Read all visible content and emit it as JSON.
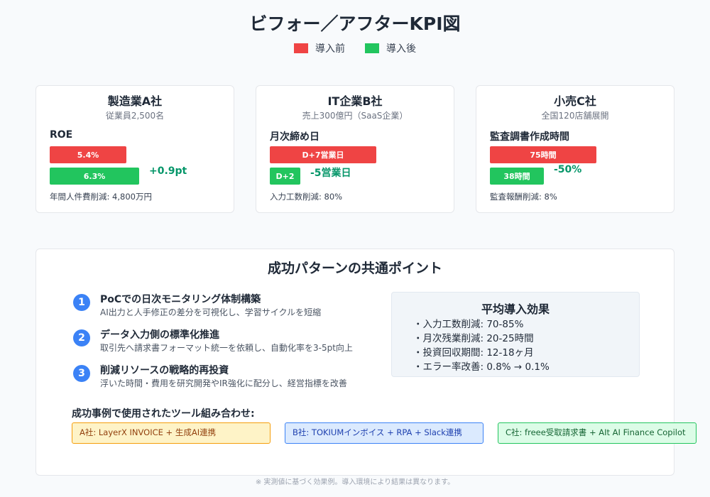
{
  "title": "ビフォー／アフターKPI図",
  "legend": [
    {
      "label": "導入前",
      "color": "#ef4444"
    },
    {
      "label": "導入後",
      "color": "#22c55e"
    }
  ],
  "chart_data": {
    "type": "bar",
    "title": "ビフォー／アフターKPI図",
    "series": [
      {
        "name": "導入前"
      },
      {
        "name": "導入後"
      }
    ],
    "panels": [
      {
        "company": "製造業A社",
        "subtitle": "従業員2,500名",
        "metric": "ROE",
        "before": 5.4,
        "before_label": "5.4%",
        "after": 6.3,
        "after_label": "6.3%",
        "delta": "+0.9pt",
        "note": "年間人件費削減: 4,800万円"
      },
      {
        "company": "IT企業B社",
        "subtitle": "売上300億円（SaaS企業）",
        "metric": "月次締め日",
        "before": 7,
        "before_label": "D+7営業日",
        "after": 2,
        "after_label": "D+2",
        "delta": "-5営業日",
        "note": "入力工数削減: 80%"
      },
      {
        "company": "小売C社",
        "subtitle": "全国120店舗展開",
        "metric": "監査調書作成時間",
        "before": 75,
        "before_label": "75時間",
        "after": 38,
        "after_label": "38時間",
        "delta": "-50%",
        "note": "監査報酬削減: 8%"
      }
    ]
  },
  "success": {
    "title": "成功パターンの共通ポイント",
    "points": [
      {
        "num": "1",
        "title": "PoCでの日次モニタリング体制構築",
        "desc": "AI出力と人手修正の差分を可視化し、学習サイクルを短縮"
      },
      {
        "num": "2",
        "title": "データ入力側の標準化推進",
        "desc": "取引先へ請求書フォーマット統一を依頼し、自動化率を3-5pt向上"
      },
      {
        "num": "3",
        "title": "削減リソースの戦略的再投資",
        "desc": "浮いた時間・費用を研究開発やIR強化に配分し、経営指標を改善"
      }
    ],
    "average": {
      "title": "平均導入効果",
      "items": [
        "・入力工数削減: 70-85%",
        "・月次残業削減: 20-25時間",
        "・投資回収期間: 12-18ヶ月",
        "・エラー率改善: 0.8% → 0.1%"
      ]
    },
    "tools_label": "成功事例で使用されたツール組み合わせ:",
    "tools": [
      "A社: LayerX INVOICE + 生成AI連携",
      "B社: TOKIUMインボイス + RPA + Slack連携",
      "C社: freee受取請求書 + AIt AI Finance Copilot"
    ]
  },
  "footnote": "※ 実測値に基づく効果例。導入環境により結果は異なります。"
}
